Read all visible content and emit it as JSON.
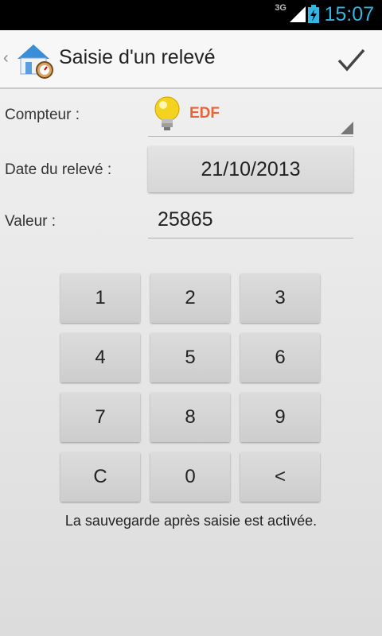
{
  "status_bar": {
    "network": "3G",
    "time": "15:07"
  },
  "action_bar": {
    "title": "Saisie d'un relevé"
  },
  "form": {
    "meter_label": "Compteur :",
    "meter_value": "EDF",
    "date_label": "Date du relevé :",
    "date_value": "21/10/2013",
    "value_label": "Valeur :",
    "value_input": "25865"
  },
  "keypad": {
    "keys": [
      "1",
      "2",
      "3",
      "4",
      "5",
      "6",
      "7",
      "8",
      "9",
      "C",
      "0",
      "<"
    ]
  },
  "footer": {
    "note": "La sauvegarde après saisie est activée."
  },
  "colors": {
    "accent": "#33b5e5",
    "meter_value": "#e8643a"
  }
}
